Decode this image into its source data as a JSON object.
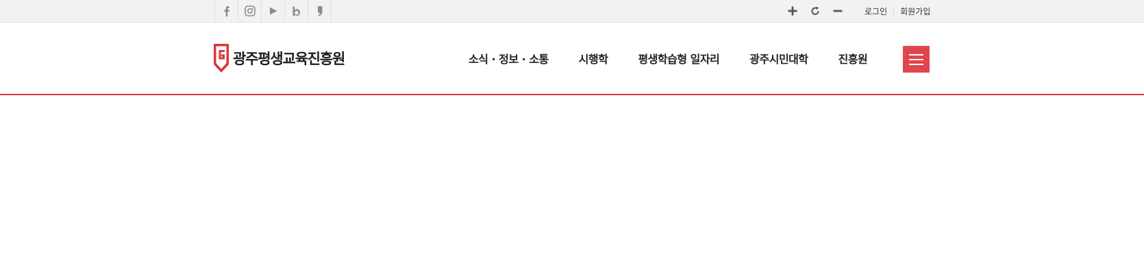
{
  "topbar": {
    "sns": [
      {
        "icon": "facebook-icon",
        "color": "#8c8c8c"
      },
      {
        "icon": "instagram-icon",
        "color": "#8c8c8c"
      },
      {
        "icon": "youtube-icon",
        "color": "#8c8c8c"
      },
      {
        "icon": "blog-icon",
        "color": "#8c8c8c"
      },
      {
        "icon": "kakao-story-icon",
        "color": "#8c8c8c"
      }
    ],
    "zoom": {
      "in_icon": "plus-icon",
      "reset_icon": "refresh-icon",
      "out_icon": "minus-icon"
    },
    "member": {
      "login_label": "로그인",
      "join_label": "회원가입"
    }
  },
  "header": {
    "logo": {
      "text": "광주평생교육진흥원",
      "mark_color": "#d9363e"
    },
    "nav": [
      "소식 · 정보 · 소통",
      "시행학",
      "평생학습형 일자리",
      "광주시민대학",
      "진흥원"
    ],
    "menu_button_icon": "hamburger-menu-icon",
    "accent_color": "#d9363e"
  }
}
